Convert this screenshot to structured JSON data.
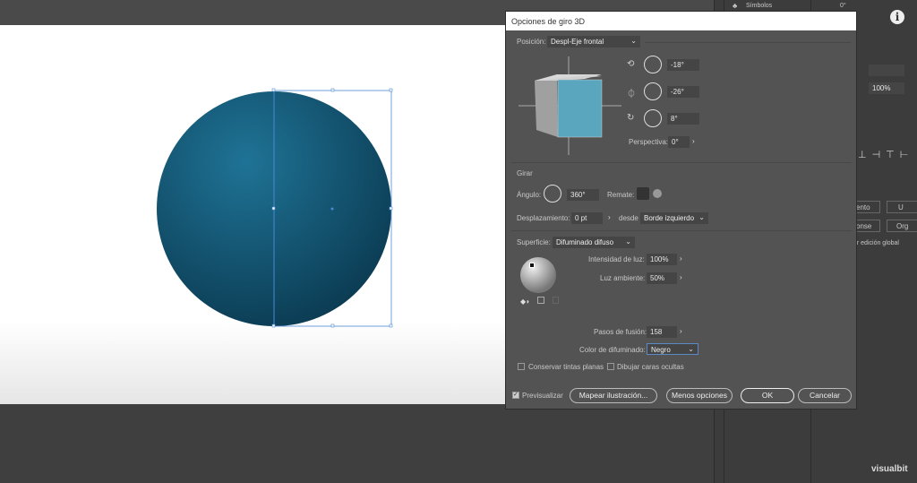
{
  "panel": {
    "symbols_label": "Símbolos",
    "angle_value": "0°",
    "zoom_value": "100%",
    "btn1": "ento",
    "btn2": "U",
    "btn3": "onse",
    "btn4": "Org",
    "global_edit": "ur edición global",
    "watermark": "visualbit"
  },
  "dialog": {
    "title": "Opciones de giro 3D",
    "position_label": "Posición:",
    "position_value": "Despl-Eje frontal",
    "rot_x": "-18°",
    "rot_y": "-26°",
    "rot_z": "8°",
    "perspective_label": "Perspectiva:",
    "perspective_value": "0°",
    "revolve_section": "Girar",
    "angle_label": "Ángulo:",
    "angle_value": "360°",
    "cap_label": "Remate:",
    "offset_label": "Desplazamiento:",
    "offset_value": "0 pt",
    "from_label": "desde",
    "from_value": "Borde izquierdo",
    "surface_label": "Superficie:",
    "surface_value": "Difuminado difuso",
    "light_intensity_label": "Intensidad de luz:",
    "light_intensity_value": "100%",
    "ambient_label": "Luz ambiente:",
    "ambient_value": "50%",
    "blend_steps_label": "Pasos de fusión:",
    "blend_steps_value": "158",
    "shade_color_label": "Color de difuminado:",
    "shade_color_value": "Negro",
    "preserve_spot": "Conservar tintas planas",
    "draw_hidden": "Dibujar caras ocultas",
    "preview": "Previsualizar",
    "map_art": "Mapear ilustración...",
    "fewer_options": "Menos opciones",
    "ok": "OK",
    "cancel": "Cancelar"
  },
  "colors": {
    "sphere": "#17607f",
    "cube_front": "#5aa6bf",
    "selection": "#4a8ad4"
  }
}
